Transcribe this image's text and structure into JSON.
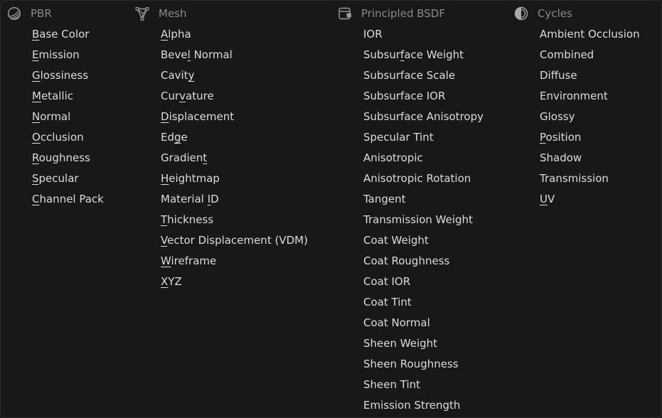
{
  "columns": [
    {
      "id": "pbr",
      "title": "PBR",
      "icon": "shading-ball-icon",
      "items": [
        {
          "pre": "",
          "key": "B",
          "post": "ase Color"
        },
        {
          "pre": "",
          "key": "E",
          "post": "mission"
        },
        {
          "pre": "",
          "key": "G",
          "post": "lossiness"
        },
        {
          "pre": "",
          "key": "M",
          "post": "etallic"
        },
        {
          "pre": "",
          "key": "N",
          "post": "ormal"
        },
        {
          "pre": "",
          "key": "O",
          "post": "cclusion"
        },
        {
          "pre": "",
          "key": "R",
          "post": "oughness"
        },
        {
          "pre": "",
          "key": "S",
          "post": "pecular"
        },
        {
          "pre": "",
          "key": "C",
          "post": "hannel Pack"
        }
      ]
    },
    {
      "id": "mesh",
      "title": "Mesh",
      "icon": "mesh-vertices-icon",
      "items": [
        {
          "pre": "",
          "key": "A",
          "post": "lpha"
        },
        {
          "pre": "Beve",
          "key": "l",
          "post": " Normal"
        },
        {
          "pre": "Cavit",
          "key": "y",
          "post": ""
        },
        {
          "pre": "Cur",
          "key": "v",
          "post": "ature"
        },
        {
          "pre": "",
          "key": "D",
          "post": "isplacement"
        },
        {
          "pre": "Ed",
          "key": "g",
          "post": "e"
        },
        {
          "pre": "Gradien",
          "key": "t",
          "post": ""
        },
        {
          "pre": "",
          "key": "H",
          "post": "eightmap"
        },
        {
          "pre": "Material ",
          "key": "I",
          "post": "D"
        },
        {
          "pre": "",
          "key": "T",
          "post": "hickness"
        },
        {
          "pre": "",
          "key": "V",
          "post": "ector Displacement (VDM)"
        },
        {
          "pre": "",
          "key": "W",
          "post": "ireframe"
        },
        {
          "pre": "",
          "key": "X",
          "post": "YZ"
        }
      ]
    },
    {
      "id": "principled",
      "title": "Principled BSDF",
      "icon": "node-icon",
      "items": [
        {
          "pre": "IOR",
          "key": "",
          "post": ""
        },
        {
          "pre": "Subsur",
          "key": "f",
          "post": "ace Weight"
        },
        {
          "pre": "Subsurface Scale",
          "key": "",
          "post": ""
        },
        {
          "pre": "Subsurface IOR",
          "key": "",
          "post": ""
        },
        {
          "pre": "Subsurface Anisotropy",
          "key": "",
          "post": ""
        },
        {
          "pre": "Specular Tint",
          "key": "",
          "post": ""
        },
        {
          "pre": "Anisotropic",
          "key": "",
          "post": ""
        },
        {
          "pre": "Anisotropic Rotation",
          "key": "",
          "post": ""
        },
        {
          "pre": "Tangent",
          "key": "",
          "post": ""
        },
        {
          "pre": "Transmission Weight",
          "key": "",
          "post": ""
        },
        {
          "pre": "Coat Weight",
          "key": "",
          "post": ""
        },
        {
          "pre": "Coat Roughness",
          "key": "",
          "post": ""
        },
        {
          "pre": "Coat IOR",
          "key": "",
          "post": ""
        },
        {
          "pre": "Coat Tint",
          "key": "",
          "post": ""
        },
        {
          "pre": "Coat Normal",
          "key": "",
          "post": ""
        },
        {
          "pre": "Sheen Weight",
          "key": "",
          "post": ""
        },
        {
          "pre": "Sheen Roughness",
          "key": "",
          "post": ""
        },
        {
          "pre": "Sheen Tint",
          "key": "",
          "post": ""
        },
        {
          "pre": "Emission Strength",
          "key": "",
          "post": ""
        }
      ]
    },
    {
      "id": "cycles",
      "title": "Cycles",
      "icon": "cycles-render-icon",
      "items": [
        {
          "pre": "Ambient Occlusion",
          "key": "",
          "post": ""
        },
        {
          "pre": "Combined",
          "key": "",
          "post": ""
        },
        {
          "pre": "Diffuse",
          "key": "",
          "post": ""
        },
        {
          "pre": "Environment",
          "key": "",
          "post": ""
        },
        {
          "pre": "Glossy",
          "key": "",
          "post": ""
        },
        {
          "pre": "",
          "key": "P",
          "post": "osition"
        },
        {
          "pre": "Shadow",
          "key": "",
          "post": ""
        },
        {
          "pre": "Transmission",
          "key": "",
          "post": ""
        },
        {
          "pre": "",
          "key": "U",
          "post": "V"
        }
      ]
    }
  ]
}
